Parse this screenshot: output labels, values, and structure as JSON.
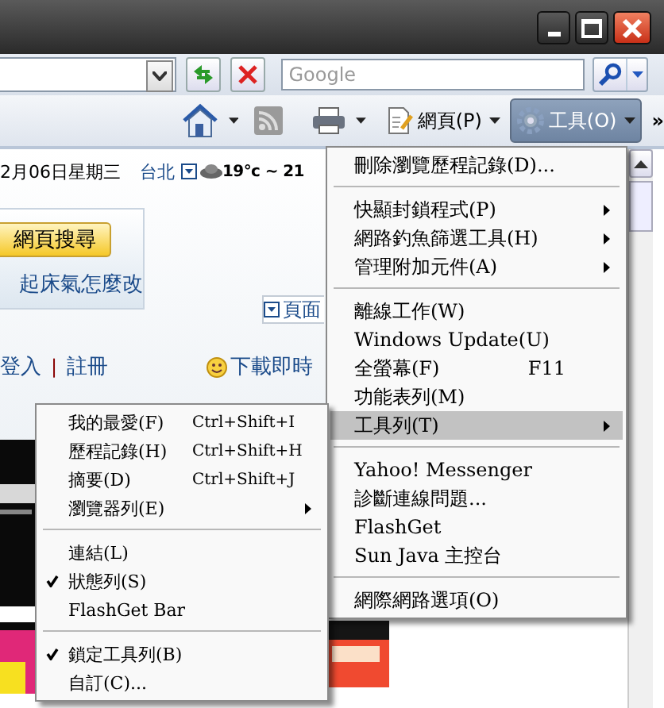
{
  "search": {
    "placeholder": "Google"
  },
  "command_bar": {
    "buttons": [
      {
        "label": "網頁(P)",
        "pressed": false
      },
      {
        "label": "工具(O)",
        "pressed": true
      }
    ],
    "overflow": "»"
  },
  "page": {
    "date": "2月06日星期三",
    "city": "台北",
    "weather": "19°c ~ 21",
    "search_button": "網頁搜尋",
    "link": "起床氣怎麼改",
    "page_menu": "頁面",
    "login": "登入",
    "separator": "|",
    "register": "註冊",
    "download": "下載即時"
  },
  "tools_menu": {
    "items": [
      {
        "kind": "item",
        "label": "刪除瀏覽歷程記錄(D)...",
        "submenu": false,
        "selected": false
      },
      {
        "kind": "separator"
      },
      {
        "kind": "item",
        "label": "快顯封鎖程式(P)",
        "submenu": true,
        "selected": false
      },
      {
        "kind": "item",
        "label": "網路釣魚篩選工具(H)",
        "submenu": true,
        "selected": false
      },
      {
        "kind": "item",
        "label": "管理附加元件(A)",
        "submenu": true,
        "selected": false
      },
      {
        "kind": "separator"
      },
      {
        "kind": "item",
        "label": "離線工作(W)",
        "submenu": false,
        "selected": false
      },
      {
        "kind": "item",
        "label": "Windows Update(U)",
        "submenu": false,
        "selected": false
      },
      {
        "kind": "item",
        "label": "全螢幕(F)",
        "shortcut": "F11",
        "submenu": false,
        "selected": false
      },
      {
        "kind": "item",
        "label": "功能表列(M)",
        "submenu": false,
        "selected": false
      },
      {
        "kind": "item",
        "label": "工具列(T)",
        "submenu": true,
        "selected": true
      },
      {
        "kind": "separator"
      },
      {
        "kind": "item",
        "label": "Yahoo! Messenger",
        "submenu": false,
        "selected": false
      },
      {
        "kind": "item",
        "label": "診斷連線問題...",
        "submenu": false,
        "selected": false
      },
      {
        "kind": "item",
        "label": "FlashGet",
        "submenu": false,
        "selected": false
      },
      {
        "kind": "item",
        "label": "Sun Java 主控台",
        "submenu": false,
        "selected": false
      },
      {
        "kind": "separator"
      },
      {
        "kind": "item",
        "label": "網際網路選項(O)",
        "submenu": false,
        "selected": false
      }
    ]
  },
  "toolbars_menu": {
    "items": [
      {
        "kind": "item",
        "label": "我的最愛(F)",
        "shortcut": "Ctrl+Shift+I",
        "checked": false,
        "submenu": false
      },
      {
        "kind": "item",
        "label": "歷程記錄(H)",
        "shortcut": "Ctrl+Shift+H",
        "checked": false,
        "submenu": false
      },
      {
        "kind": "item",
        "label": "摘要(D)",
        "shortcut": "Ctrl+Shift+J",
        "checked": false,
        "submenu": false
      },
      {
        "kind": "item",
        "label": "瀏覽器列(E)",
        "checked": false,
        "submenu": true
      },
      {
        "kind": "separator"
      },
      {
        "kind": "item",
        "label": "連結(L)",
        "checked": false,
        "submenu": false
      },
      {
        "kind": "item",
        "label": "狀態列(S)",
        "checked": true,
        "submenu": false
      },
      {
        "kind": "item",
        "label": "FlashGet Bar",
        "checked": false,
        "submenu": false
      },
      {
        "kind": "separator"
      },
      {
        "kind": "item",
        "label": "鎖定工具列(B)",
        "checked": true,
        "submenu": false
      },
      {
        "kind": "item",
        "label": "自訂(C)...",
        "checked": false,
        "submenu": false
      }
    ]
  }
}
